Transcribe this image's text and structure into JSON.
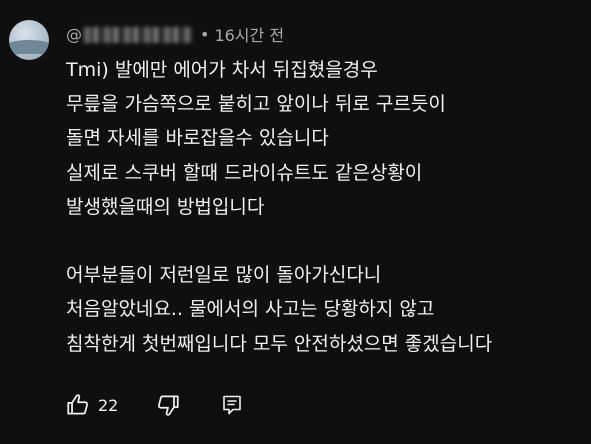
{
  "comment": {
    "handle_prefix": "@",
    "dot": "•",
    "timestamp": "16시간 전",
    "lines": [
      "Tmi) 발에만 에어가 차서 뒤집혔을경우",
      "무릎을 가슴쪽으로 붙히고 앞이나 뒤로 구르듯이",
      "돌면 자세를 바로잡을수 있습니다",
      "실제로 스쿠버 할때 드라이슈트도 같은상황이",
      "발생했을때의 방법입니다",
      "",
      "어부분들이 저런일로 많이 돌아가신다니",
      "처음알았네요.. 물에서의 사고는 당황하지 않고",
      "침착한게 첫번째입니다 모두 안전하셨으면 좋겠습니다"
    ],
    "like_count": "22"
  },
  "colors": {
    "background": "#0f0f0f",
    "primary_text": "#f1f1f1",
    "secondary_text": "#aaaaaa"
  },
  "icons": {
    "like": "thumbs-up-icon",
    "dislike": "thumbs-down-icon",
    "reply": "reply-comment-icon"
  }
}
